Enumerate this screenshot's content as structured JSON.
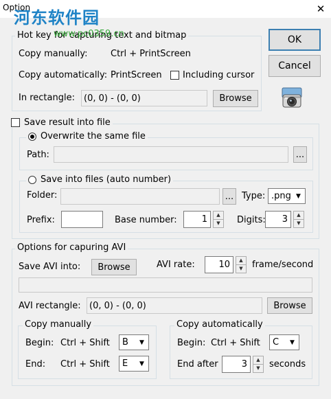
{
  "window": {
    "title": "Option",
    "close_glyph": "✕",
    "watermark": "河东软件园",
    "watermark_url": "www.pc0359.cn"
  },
  "hotkey": {
    "legend": "Hot key for capturing text and bitmap",
    "copy_manually_label": "Copy manually:",
    "copy_manually_value": "Ctrl + PrintScreen",
    "copy_auto_label": "Copy automatically:",
    "copy_auto_value": "PrintScreen",
    "including_cursor_label": "Including cursor",
    "in_rectangle_label": "In rectangle:",
    "in_rectangle_value": "(0, 0) - (0, 0)",
    "browse_label": "Browse"
  },
  "dialog": {
    "ok_label": "OK",
    "cancel_label": "Cancel",
    "camera_icon": "camera-icon"
  },
  "save": {
    "save_result_label": "Save result into file",
    "overwrite_label": "Overwrite the same file",
    "path_label": "Path:",
    "path_value": "",
    "browse_dots": "...",
    "save_files_label": "Save into files (auto number)",
    "folder_label": "Folder:",
    "folder_value": "",
    "type_label": "Type:",
    "type_value": ".png",
    "prefix_label": "Prefix:",
    "prefix_value": "",
    "base_number_label": "Base number:",
    "base_number_value": "1",
    "digits_label": "Digits:",
    "digits_value": "3"
  },
  "avi": {
    "legend": "Options for capuring AVI",
    "save_into_label": "Save AVI into:",
    "browse_label": "Browse",
    "rate_label": "AVI rate:",
    "rate_value": "10",
    "rate_unit": "frame/second",
    "path_value": "",
    "rectangle_label": "AVI rectangle:",
    "rectangle_value": "(0, 0) - (0, 0)",
    "rectangle_browse": "Browse",
    "copy_manually": {
      "legend": "Copy manually",
      "begin_label": "Begin:",
      "begin_mod": "Ctrl + Shift",
      "begin_key": "B",
      "end_label": "End:",
      "end_mod": "Ctrl + Shift",
      "end_key": "E"
    },
    "copy_auto": {
      "legend": "Copy automatically",
      "begin_label": "Begin:",
      "begin_mod": "Ctrl + Shift",
      "begin_key": "C",
      "end_label": "End after",
      "end_value": "3",
      "end_unit": "seconds"
    }
  },
  "glyphs": {
    "spin_up": "▲",
    "spin_down": "▼",
    "combo_arrow": "▼"
  }
}
